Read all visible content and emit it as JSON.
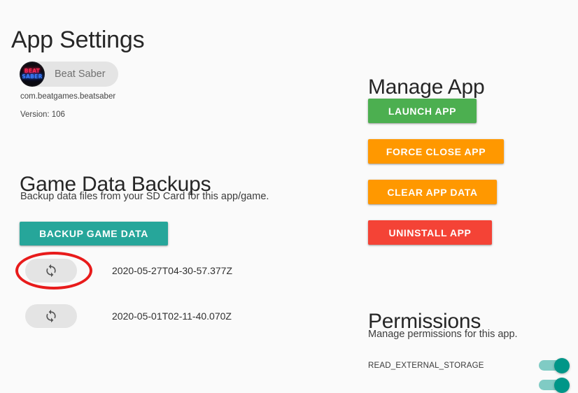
{
  "page": {
    "title": "App Settings",
    "background_color": "#fafafa"
  },
  "app_info": {
    "chip_label": "Beat Saber",
    "icon_name": "beat-saber-app-icon",
    "icon_text_top": "BEAT",
    "icon_text_bottom": "SABER",
    "package_name": "com.beatgames.beatsaber",
    "version_text": "Version: 106"
  },
  "backups": {
    "heading": "Game Data Backups",
    "subtitle": "Backup data files from your SD Card for this app/game.",
    "backup_button_label": "BACKUP GAME DATA",
    "backup_button_color": "#26a69a",
    "restore_icon_name": "sync-restore-icon",
    "items": [
      {
        "timestamp": "2020-05-27T04-30-57.377Z",
        "highlighted": true
      },
      {
        "timestamp": "2020-05-01T02-11-40.070Z",
        "highlighted": false
      }
    ],
    "annotation": {
      "shape": "ellipse",
      "color": "#e81b1b",
      "targets": "restore-button-row-1"
    }
  },
  "manage_app": {
    "heading": "Manage App",
    "buttons": [
      {
        "label": "LAUNCH APP",
        "color": "#4caf50"
      },
      {
        "label": "FORCE CLOSE APP",
        "color": "#ff9800"
      },
      {
        "label": "CLEAR APP DATA",
        "color": "#ff9800"
      },
      {
        "label": "UNINSTALL APP",
        "color": "#f44336"
      }
    ]
  },
  "permissions": {
    "heading": "Permissions",
    "subtitle": "Manage permissions for this app.",
    "toggle_on_color": "#009688",
    "toggle_track_color": "#80cbc4",
    "items": [
      {
        "name": "READ_EXTERNAL_STORAGE",
        "enabled": true
      }
    ]
  }
}
